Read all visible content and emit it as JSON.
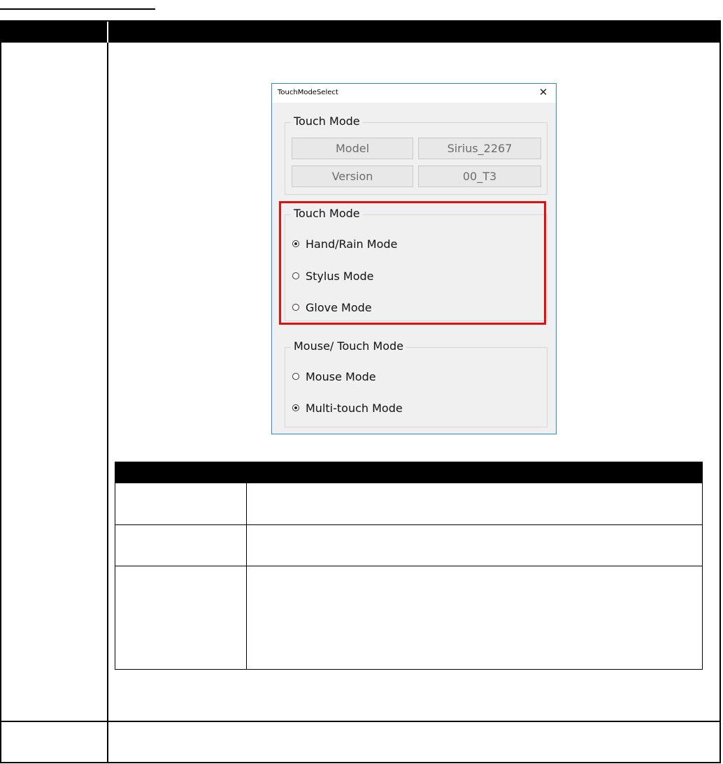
{
  "dialog": {
    "title": "TouchModeSelect",
    "close_icon": "close-icon",
    "info_group": {
      "legend": "Touch Mode",
      "model_label": "Model",
      "model_value": "Sirius_2267",
      "version_label": "Version",
      "version_value": "00_T3"
    },
    "touch_mode_group": {
      "legend": "Touch Mode",
      "options": [
        {
          "label": "Hand/Rain Mode",
          "checked": true
        },
        {
          "label": "Stylus Mode",
          "checked": false
        },
        {
          "label": "Glove Mode",
          "checked": false
        }
      ]
    },
    "mouse_touch_group": {
      "legend": "Mouse/ Touch Mode",
      "options": [
        {
          "label": "Mouse Mode",
          "checked": false
        },
        {
          "label": "Multi-touch Mode",
          "checked": true
        }
      ]
    }
  },
  "colors": {
    "highlight": "#e01010",
    "dialog_border": "#2f87d8",
    "dialog_bg": "#f0f0f0",
    "header_bg": "#000000"
  }
}
